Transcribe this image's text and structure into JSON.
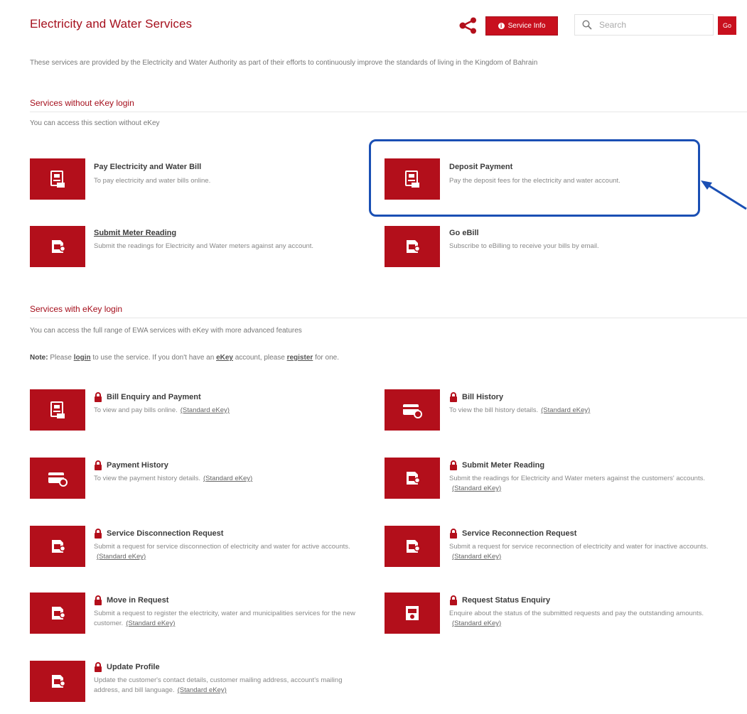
{
  "header": {
    "title": "Electricity and Water Services",
    "service_info_label": "Service Info",
    "search_placeholder": "Search",
    "go_label": "Go"
  },
  "intro": "These services are provided by the Electricity and Water Authority as part of their efforts to continuously improve the standards of living in the Kingdom of Bahrain",
  "section_without": {
    "title": "Services without eKey login",
    "subtitle": "You can access this section without eKey",
    "services": [
      {
        "title": "Pay Electricity and Water Bill",
        "desc": "To pay electricity and water bills online.",
        "icon": "bill-icon"
      },
      {
        "title": "Deposit Payment",
        "desc": "Pay the deposit fees for the electricity and water account.",
        "icon": "bill-icon"
      },
      {
        "title": "Submit Meter Reading",
        "desc": "Submit the readings for Electricity and Water meters against any account.",
        "icon": "meter-icon"
      },
      {
        "title": "Go eBill",
        "desc": "Subscribe to eBilling to receive your bills by email.",
        "icon": "meter-icon"
      }
    ]
  },
  "section_with": {
    "title": "Services with eKey login",
    "subtitle": "You can access the full range of EWA services with eKey with more advanced features",
    "note": {
      "label": "Note:",
      "text1": "Please",
      "login": "login",
      "text2": "to use the service. If you don't have an",
      "ekey": "eKey",
      "text3": "account, please",
      "register": "register",
      "text4": "for one."
    },
    "standard_ekey": "(Standard eKey)",
    "services": [
      {
        "title": "Bill Enquiry and Payment",
        "desc": "To view and pay bills online.",
        "icon": "bill-icon"
      },
      {
        "title": "Bill History",
        "desc": "To view the bill history details.",
        "icon": "card-icon"
      },
      {
        "title": "Payment History",
        "desc": "To view the payment history details.",
        "icon": "card-icon"
      },
      {
        "title": "Submit Meter Reading",
        "desc": "Submit the readings for Electricity and Water meters against the customers' accounts.",
        "icon": "meter-icon"
      },
      {
        "title": "Service Disconnection Request",
        "desc": "Submit a request for service disconnection of electricity and water for active accounts.",
        "icon": "meter-icon"
      },
      {
        "title": "Service Reconnection Request",
        "desc": "Submit a request for service reconnection of electricity and water for inactive accounts.",
        "icon": "meter-icon"
      },
      {
        "title": "Move in Request",
        "desc": "Submit a request to register the electricity, water and municipalities services for the new customer.",
        "icon": "meter-icon"
      },
      {
        "title": "Request Status Enquiry",
        "desc": "Enquire about the status of the submitted requests and pay the outstanding amounts.",
        "icon": "status-icon"
      },
      {
        "title": "Update Profile",
        "desc": "Update the customer's contact details, customer mailing address, account's mailing address, and bill language.",
        "icon": "meter-icon"
      }
    ]
  },
  "colors": {
    "brand": "#b30f1b",
    "annotation": "#1a4fb4"
  }
}
